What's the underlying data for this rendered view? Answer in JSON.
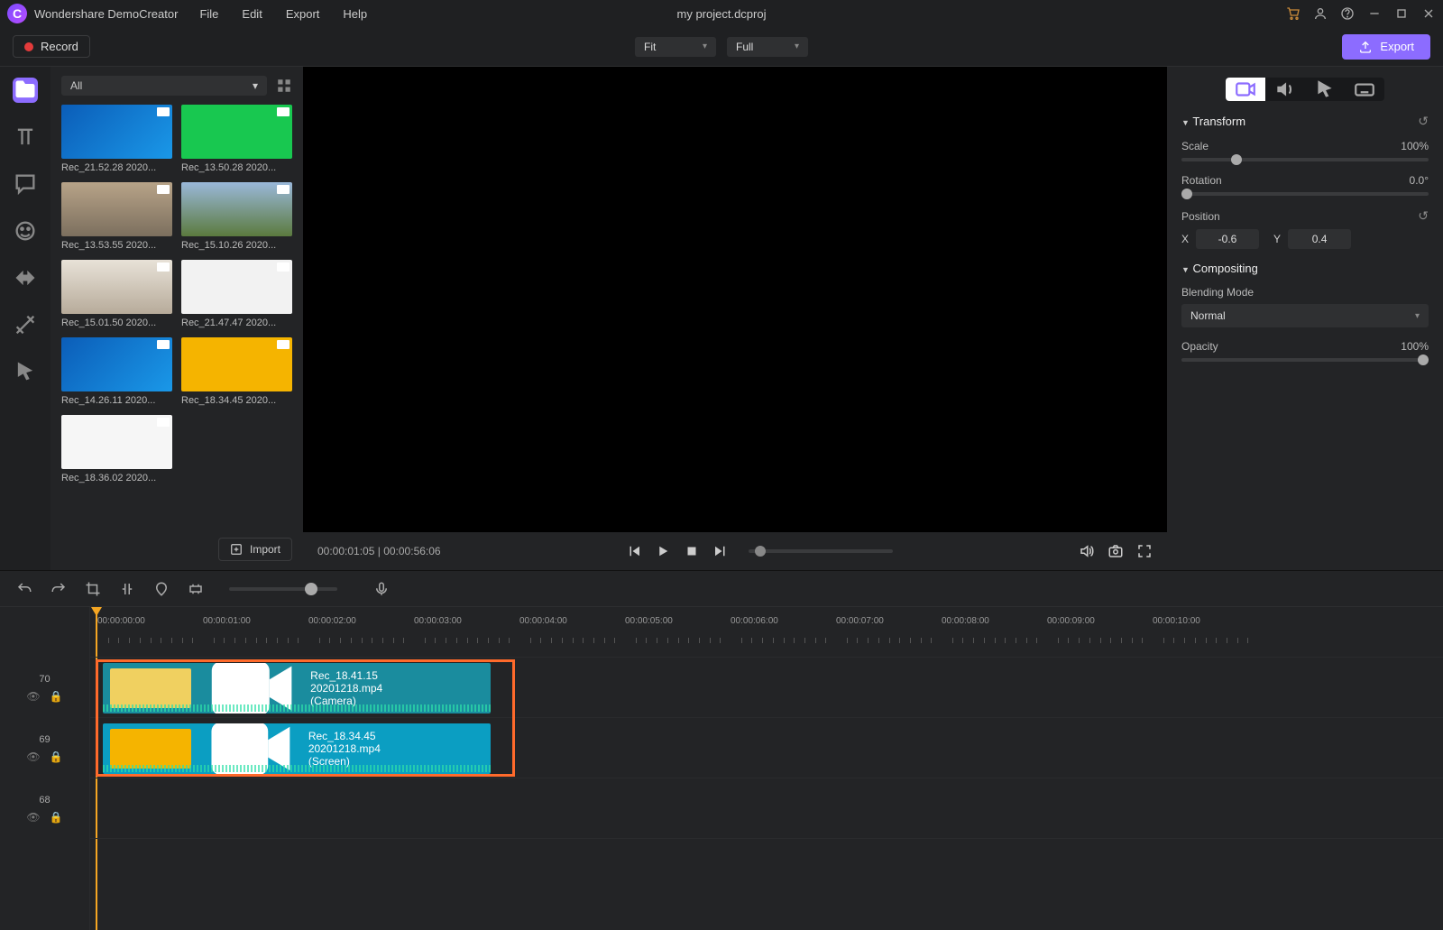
{
  "app_name": "Wondershare DemoCreator",
  "menu": [
    "File",
    "Edit",
    "Export",
    "Help"
  ],
  "doc_title": "my project.dcproj",
  "record_label": "Record",
  "view_fit": "Fit",
  "view_full": "Full",
  "export_label": "Export",
  "media_filter": "All",
  "import_label": "Import",
  "clips": [
    {
      "name": "Rec_21.52.28 2020...",
      "bg": "linear-gradient(135deg,#0b5db8,#1a98e8)"
    },
    {
      "name": "Rec_13.50.28 2020...",
      "bg": "#18c850"
    },
    {
      "name": "Rec_13.53.55 2020...",
      "bg": "linear-gradient(#b7a388,#7c6f5e)"
    },
    {
      "name": "Rec_15.10.26 2020...",
      "bg": "linear-gradient(#9ab8d9,#5b7a3e)"
    },
    {
      "name": "Rec_15.01.50 2020...",
      "bg": "linear-gradient(#e8e2d8,#b7ab9a)"
    },
    {
      "name": "Rec_21.47.47 2020...",
      "bg": "#f2f2f2"
    },
    {
      "name": "Rec_14.26.11 2020...",
      "bg": "linear-gradient(135deg,#0b5db8,#1a98e8)"
    },
    {
      "name": "Rec_18.34.45 2020...",
      "bg": "#f5b400"
    },
    {
      "name": "Rec_18.36.02 2020...",
      "bg": "#f6f6f6"
    }
  ],
  "time_current": "00:00:01:05",
  "time_total": "00:00:56:06",
  "props": {
    "transform_label": "Transform",
    "scale_label": "Scale",
    "scale_value": "100%",
    "rotation_label": "Rotation",
    "rotation_value": "0.0°",
    "position_label": "Position",
    "x_label": "X",
    "x_value": "-0.6",
    "y_label": "Y",
    "y_value": "0.4",
    "compositing_label": "Compositing",
    "blend_label": "Blending Mode",
    "blend_value": "Normal",
    "opacity_label": "Opacity",
    "opacity_value": "100%"
  },
  "ruler_ticks": [
    "00:00:00:00",
    "00:00:01:00",
    "00:00:02:00",
    "00:00:03:00",
    "00:00:04:00",
    "00:00:05:00",
    "00:00:06:00",
    "00:00:07:00",
    "00:00:08:00",
    "00:00:09:00",
    "00:00:10:00"
  ],
  "tracks": [
    {
      "id": "70"
    },
    {
      "id": "69"
    },
    {
      "id": "68"
    }
  ],
  "tlclips": [
    {
      "track": 0,
      "name": "Rec_18.41.15 20201218.mp4 (Camera)",
      "bg": "#1a8c9e",
      "thumb": "#f0d060"
    },
    {
      "track": 1,
      "name": "Rec_18.34.45 20201218.mp4 (Screen)",
      "bg": "#0b9ec2",
      "thumb": "#f5b400"
    }
  ]
}
